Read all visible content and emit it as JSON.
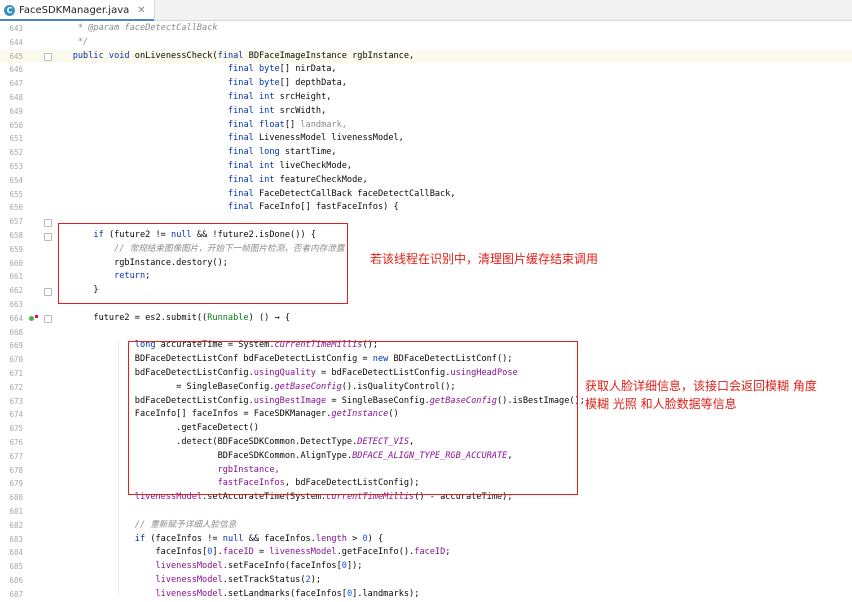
{
  "tab": {
    "icon": "java-class-icon",
    "filename": "FaceSDKManager.java"
  },
  "annotations": {
    "note1": "若该线程在识别中，清理图片缓存结束调用",
    "note2_line1": "获取人脸详细信息，该接口会返回模糊 角度",
    "note2_line2": "模糊 光照 和人脸数据等信息"
  },
  "lines": [
    {
      "n": "643",
      "segs": [
        {
          "t": "     * ",
          "c": "cm"
        },
        {
          "t": "@param",
          "c": "cm"
        },
        {
          "t": " faceDetectCallBack",
          "c": "cm"
        }
      ]
    },
    {
      "n": "644",
      "segs": [
        {
          "t": "     */",
          "c": "cm"
        }
      ]
    },
    {
      "n": "645",
      "hl": true,
      "segs": [
        {
          "t": "    public void ",
          "c": "kw"
        },
        {
          "t": "onLivenessCheck("
        },
        {
          "t": "final ",
          "c": "kw"
        },
        {
          "t": "BDFaceImageInstance rgbInstance,"
        }
      ]
    },
    {
      "n": "646",
      "segs": [
        {
          "t": "                                  "
        },
        {
          "t": "final ",
          "c": "kw"
        },
        {
          "t": "byte",
          "c": "kw"
        },
        {
          "t": "[] nirData,"
        }
      ]
    },
    {
      "n": "647",
      "segs": [
        {
          "t": "                                  "
        },
        {
          "t": "final ",
          "c": "kw"
        },
        {
          "t": "byte",
          "c": "kw"
        },
        {
          "t": "[] depthData,"
        }
      ]
    },
    {
      "n": "648",
      "segs": [
        {
          "t": "                                  "
        },
        {
          "t": "final int ",
          "c": "kw"
        },
        {
          "t": "srcHeight,"
        }
      ]
    },
    {
      "n": "649",
      "segs": [
        {
          "t": "                                  "
        },
        {
          "t": "final int ",
          "c": "kw"
        },
        {
          "t": "srcWidth,"
        }
      ]
    },
    {
      "n": "650",
      "segs": [
        {
          "t": "                                  "
        },
        {
          "t": "final float",
          "c": "kw"
        },
        {
          "t": "[] "
        },
        {
          "t": "landmark,",
          "c": "grey"
        }
      ]
    },
    {
      "n": "651",
      "segs": [
        {
          "t": "                                  "
        },
        {
          "t": "final ",
          "c": "kw"
        },
        {
          "t": "LivenessModel livenessModel,"
        }
      ]
    },
    {
      "n": "652",
      "segs": [
        {
          "t": "                                  "
        },
        {
          "t": "final long ",
          "c": "kw"
        },
        {
          "t": "startTime,"
        }
      ]
    },
    {
      "n": "653",
      "segs": [
        {
          "t": "                                  "
        },
        {
          "t": "final int ",
          "c": "kw"
        },
        {
          "t": "liveCheckMode,"
        }
      ]
    },
    {
      "n": "654",
      "segs": [
        {
          "t": "                                  "
        },
        {
          "t": "final int ",
          "c": "kw"
        },
        {
          "t": "featureCheckMode,"
        }
      ]
    },
    {
      "n": "655",
      "segs": [
        {
          "t": "                                  "
        },
        {
          "t": "final ",
          "c": "kw"
        },
        {
          "t": "FaceDetectCallBack faceDetectCallBack,"
        }
      ]
    },
    {
      "n": "656",
      "segs": [
        {
          "t": "                                  "
        },
        {
          "t": "final ",
          "c": "kw"
        },
        {
          "t": "FaceInfo[] fastFaceInfos) {"
        }
      ]
    },
    {
      "n": "657",
      "segs": []
    },
    {
      "n": "658",
      "segs": [
        {
          "t": "        "
        },
        {
          "t": "if ",
          "c": "kw"
        },
        {
          "t": "(future2 != "
        },
        {
          "t": "null ",
          "c": "kw"
        },
        {
          "t": "&& !future2.isDone()) {"
        }
      ]
    },
    {
      "n": "659",
      "segs": [
        {
          "t": "            "
        },
        {
          "t": "// 常规结束图像图片，开始下一帧图片检测，否者内存泄露",
          "c": "cm"
        }
      ]
    },
    {
      "n": "660",
      "segs": [
        {
          "t": "            rgbInstance.destory();"
        }
      ]
    },
    {
      "n": "661",
      "segs": [
        {
          "t": "            "
        },
        {
          "t": "return",
          "c": "kw"
        },
        {
          "t": ";"
        }
      ]
    },
    {
      "n": "662",
      "segs": [
        {
          "t": "        }"
        }
      ]
    },
    {
      "n": "663",
      "segs": []
    },
    {
      "n": "664",
      "segs": [
        {
          "t": "        future2 = es2.submit(("
        },
        {
          "t": "Runnable",
          "c": "cn"
        },
        {
          "t": ") () → {"
        }
      ]
    },
    {
      "n": "668",
      "segs": []
    },
    {
      "n": "669",
      "segs": [
        {
          "t": "                "
        },
        {
          "t": "long ",
          "c": "kw"
        },
        {
          "t": "accurateTime = System."
        },
        {
          "t": "currentTimeMillis",
          "c": "st"
        },
        {
          "t": "();"
        }
      ]
    },
    {
      "n": "670",
      "segs": [
        {
          "t": "                BDFaceDetectListConf bdFaceDetectListConfig = "
        },
        {
          "t": "new ",
          "c": "kw"
        },
        {
          "t": "BDFaceDetectListConf();"
        }
      ]
    },
    {
      "n": "671",
      "segs": [
        {
          "t": "                bdFaceDetectListConfig."
        },
        {
          "t": "usingQuality",
          "c": "fld"
        },
        {
          "t": " = bdFaceDetectListConfig."
        },
        {
          "t": "usingHeadPose",
          "c": "fld"
        }
      ]
    },
    {
      "n": "672",
      "segs": [
        {
          "t": "                        = SingleBaseConfig."
        },
        {
          "t": "getBaseConfig",
          "c": "st"
        },
        {
          "t": "().isQualityControl();"
        }
      ]
    },
    {
      "n": "673",
      "segs": [
        {
          "t": "                bdFaceDetectListConfig."
        },
        {
          "t": "usingBestImage",
          "c": "fld"
        },
        {
          "t": " = SingleBaseConfig."
        },
        {
          "t": "getBaseConfig",
          "c": "st"
        },
        {
          "t": "().isBestImage();"
        }
      ]
    },
    {
      "n": "674",
      "segs": [
        {
          "t": "                FaceInfo[] faceInfos = FaceSDKManager."
        },
        {
          "t": "getInstance",
          "c": "st"
        },
        {
          "t": "()"
        }
      ]
    },
    {
      "n": "675",
      "segs": [
        {
          "t": "                        .getFaceDetect()"
        }
      ]
    },
    {
      "n": "676",
      "segs": [
        {
          "t": "                        .detect(BDFaceSDKCommon.DetectType."
        },
        {
          "t": "DETECT_VIS",
          "c": "st"
        },
        {
          "t": ","
        }
      ]
    },
    {
      "n": "677",
      "segs": [
        {
          "t": "                                BDFaceSDKCommon.AlignType."
        },
        {
          "t": "BDFACE_ALIGN_TYPE_RGB_ACCURATE",
          "c": "st"
        },
        {
          "t": ","
        }
      ]
    },
    {
      "n": "678",
      "segs": [
        {
          "t": "                                "
        },
        {
          "t": "rgbInstance,",
          "c": "fld"
        }
      ]
    },
    {
      "n": "679",
      "segs": [
        {
          "t": "                                "
        },
        {
          "t": "fastFaceInfos",
          "c": "fld"
        },
        {
          "t": ", bdFaceDetectListConfig);"
        }
      ]
    },
    {
      "n": "680",
      "segs": [
        {
          "t": "                "
        },
        {
          "t": "livenessModel",
          "c": "fld"
        },
        {
          "t": ".setAccurateTime(System."
        },
        {
          "t": "currentTimeMillis",
          "c": "st"
        },
        {
          "t": "() - accurateTime);"
        }
      ]
    },
    {
      "n": "681",
      "segs": []
    },
    {
      "n": "682",
      "segs": [
        {
          "t": "                "
        },
        {
          "t": "// 重新赋予详细人脸信息",
          "c": "cm"
        }
      ]
    },
    {
      "n": "683",
      "segs": [
        {
          "t": "                "
        },
        {
          "t": "if ",
          "c": "kw"
        },
        {
          "t": "(faceInfos != "
        },
        {
          "t": "null ",
          "c": "kw"
        },
        {
          "t": "&& faceInfos."
        },
        {
          "t": "length",
          "c": "fld"
        },
        {
          "t": " > "
        },
        {
          "t": "0",
          "c": "num"
        },
        {
          "t": ") {"
        }
      ]
    },
    {
      "n": "684",
      "segs": [
        {
          "t": "                    faceInfos["
        },
        {
          "t": "0",
          "c": "num"
        },
        {
          "t": "]."
        },
        {
          "t": "faceID",
          "c": "fld"
        },
        {
          "t": " = "
        },
        {
          "t": "livenessModel",
          "c": "fld"
        },
        {
          "t": ".getFaceInfo()."
        },
        {
          "t": "faceID",
          "c": "fld"
        },
        {
          "t": ";"
        }
      ]
    },
    {
      "n": "685",
      "segs": [
        {
          "t": "                    "
        },
        {
          "t": "livenessModel",
          "c": "fld"
        },
        {
          "t": ".setFaceInfo(faceInfos["
        },
        {
          "t": "0",
          "c": "num"
        },
        {
          "t": "]);"
        }
      ]
    },
    {
      "n": "686",
      "segs": [
        {
          "t": "                    "
        },
        {
          "t": "livenessModel",
          "c": "fld"
        },
        {
          "t": ".setTrackStatus("
        },
        {
          "t": "2",
          "c": "num"
        },
        {
          "t": ");"
        }
      ]
    },
    {
      "n": "687",
      "segs": [
        {
          "t": "                    "
        },
        {
          "t": "livenessModel",
          "c": "fld"
        },
        {
          "t": ".setLandmarks(faceInfos["
        },
        {
          "t": "0",
          "c": "num"
        },
        {
          "t": "].landmarks);"
        }
      ]
    }
  ]
}
